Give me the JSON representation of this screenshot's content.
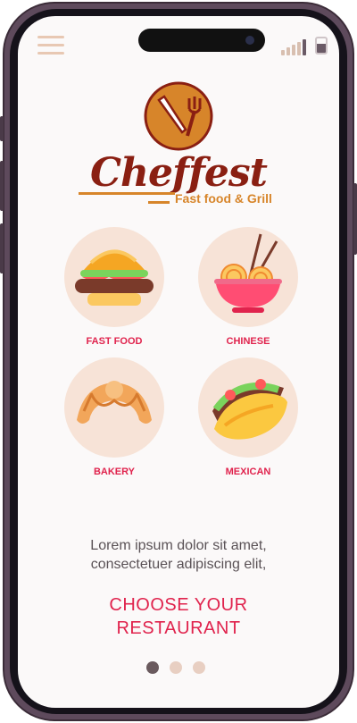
{
  "app": {
    "logo_text": "Cheffest",
    "tagline": "Fast food & Grill"
  },
  "status_bar": {
    "menu_icon": "hamburger-icon",
    "signal_icon": "signal-bars-icon",
    "battery_icon": "battery-icon"
  },
  "categories": [
    {
      "label": "FAST FOOD",
      "icon": "burger-icon"
    },
    {
      "label": "CHINESE",
      "icon": "noodle-bowl-icon"
    },
    {
      "label": "BAKERY",
      "icon": "croissant-icon"
    },
    {
      "label": "MEXICAN",
      "icon": "taco-icon"
    }
  ],
  "description": {
    "line1": "Lorem ipsum dolor sit amet,",
    "line2": "consectetuer adipiscing elit,"
  },
  "cta": {
    "line1": "CHOOSE YOUR",
    "line2": "RESTAURANT"
  },
  "pagination": {
    "total": 3,
    "active_index": 0
  },
  "colors": {
    "brand": "#8a1f12",
    "accent": "#d7852a",
    "highlight": "#e0234d",
    "circle_bg": "#f7e3d7"
  }
}
